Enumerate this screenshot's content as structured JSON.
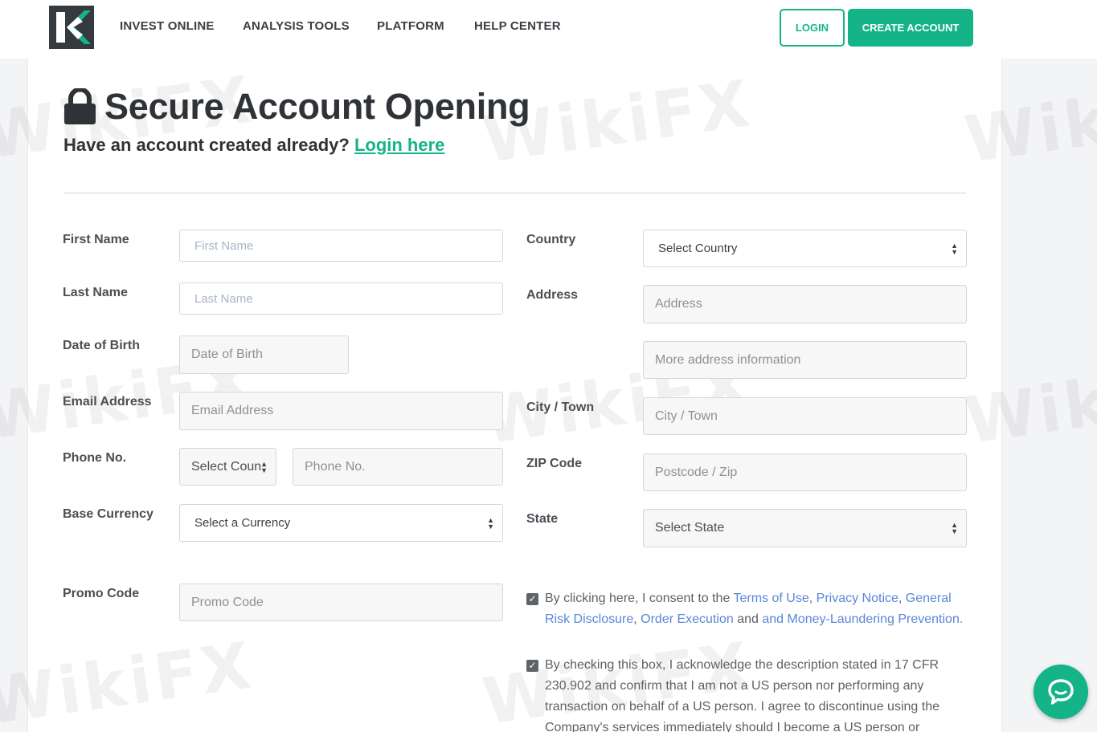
{
  "nav": {
    "items": [
      "INVEST ONLINE",
      "ANALYSIS TOOLS",
      "PLATFORM",
      "HELP CENTER"
    ],
    "login_label": "LOGIN",
    "create_label": "CREATE ACCOUNT"
  },
  "header": {
    "title": "Secure Account Opening",
    "subtitle_text": "Have an account created already?",
    "subtitle_link": "Login here"
  },
  "form": {
    "first_name": {
      "label": "First Name",
      "placeholder": "First Name"
    },
    "last_name": {
      "label": "Last Name",
      "placeholder": "Last Name"
    },
    "dob": {
      "label": "Date of Birth",
      "placeholder": "Date of Birth"
    },
    "email": {
      "label": "Email Address",
      "placeholder": "Email Address"
    },
    "phone": {
      "label": "Phone No.",
      "country_select": "Select Coun",
      "placeholder": "Phone No."
    },
    "currency": {
      "label": "Base Currency",
      "select": "Select a Currency"
    },
    "promo": {
      "label": "Promo Code",
      "placeholder": "Promo Code"
    },
    "country": {
      "label": "Country",
      "select": "Select Country"
    },
    "address": {
      "label": "Address",
      "placeholder": "Address",
      "placeholder2": "More address information"
    },
    "city": {
      "label": "City / Town",
      "placeholder": "City / Town"
    },
    "zip": {
      "label": "ZIP Code",
      "placeholder": "Postcode / Zip"
    },
    "state": {
      "label": "State",
      "select": "Select State"
    }
  },
  "consent1": {
    "checked": true,
    "pre": "By clicking here, I consent to the ",
    "terms": "Terms of Use",
    "sep1": ", ",
    "privacy": "Privacy Notice",
    "sep2": ", ",
    "risk": "General Risk Disclosure",
    "sep3": ", ",
    "execution": "Order Execution",
    "and": " and ",
    "aml": "and Money-Laundering Prevention."
  },
  "consent2": {
    "checked": true,
    "text": "By checking this box, I acknowledge the description stated in 17 CFR 230.902 and confirm that I am not a US person nor performing any transaction on behalf of a US person. I agree to discontinue using the Company's services immediately should I become a US person or perform"
  },
  "watermark": "WikiFX",
  "colors": {
    "accent": "#15b388",
    "link": "#5b86d6",
    "text": "#3a3f44"
  }
}
